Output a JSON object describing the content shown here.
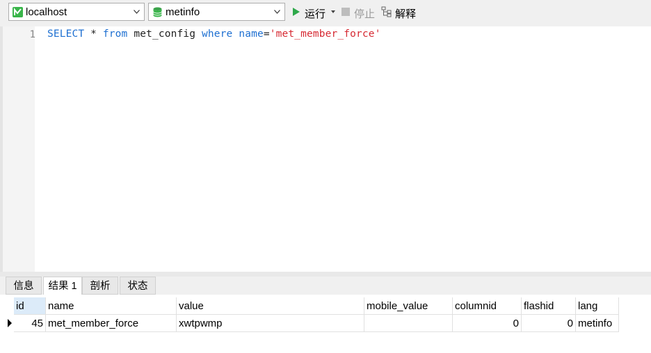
{
  "toolbar": {
    "connection": "localhost",
    "database": "metinfo",
    "run_label": "运行",
    "stop_label": "停止",
    "explain_label": "解释"
  },
  "editor": {
    "line_number": "1",
    "tokens": {
      "select": "SELECT",
      "star": " * ",
      "from": "from",
      "table": " met_config ",
      "where": "where",
      "space": " ",
      "name": "name",
      "eq": "=",
      "value": "'met_member_force'"
    }
  },
  "tabs": [
    "信息",
    "结果 1",
    "剖析",
    "状态"
  ],
  "result": {
    "columns": [
      "id",
      "name",
      "value",
      "mobile_value",
      "columnid",
      "flashid",
      "lang"
    ],
    "rows": [
      [
        "45",
        "met_member_force",
        "xwtpwmp",
        "",
        "0",
        "0",
        "metinfo"
      ]
    ]
  },
  "colors": {
    "keyword": "#1d6fd1",
    "string": "#d62a33",
    "run_green": "#2ea84a"
  }
}
